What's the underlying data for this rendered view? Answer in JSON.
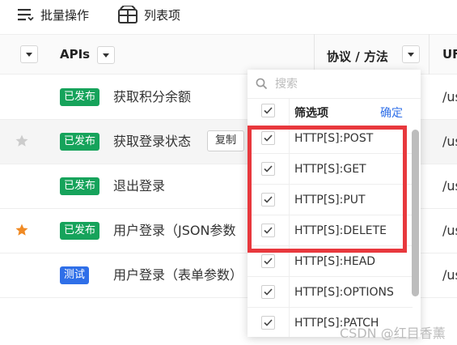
{
  "toolbar": {
    "batch_label": "批量操作",
    "list_label": "列表项"
  },
  "table": {
    "columns": {
      "apis": "APIs",
      "method": "协议 / 方法",
      "url_cut": "UF"
    },
    "rows": [
      {
        "starred": false,
        "status": "已发布",
        "status_type": "published",
        "name": "获取积分余额",
        "url": "/us"
      },
      {
        "starred": false,
        "status": "已发布",
        "status_type": "published",
        "name": "获取登录状态",
        "copy_label": "复制",
        "url": "/us",
        "highlighted": true
      },
      {
        "starred": false,
        "status": "已发布",
        "status_type": "published",
        "name": "退出登录",
        "url": "/us"
      },
      {
        "starred": true,
        "status": "已发布",
        "status_type": "published",
        "name": "用户登录（JSON参数",
        "url": "/us"
      },
      {
        "starred": false,
        "status": "测试",
        "status_type": "testing",
        "name": "用户登录（表单参数）",
        "url": "/us"
      }
    ]
  },
  "filter_dropdown": {
    "search_placeholder": "搜索",
    "title": "筛选项",
    "confirm_label": "确定",
    "options": [
      {
        "label": "HTTP[S]:POST",
        "checked": true
      },
      {
        "label": "HTTP[S]:GET",
        "checked": true
      },
      {
        "label": "HTTP[S]:PUT",
        "checked": true
      },
      {
        "label": "HTTP[S]:DELETE",
        "checked": true
      },
      {
        "label": "HTTP[S]:HEAD",
        "checked": true
      },
      {
        "label": "HTTP[S]:OPTIONS",
        "checked": true
      },
      {
        "label": "HTTP[S]:PATCH",
        "checked": true
      }
    ]
  },
  "watermark": "CSDN @红目香薰",
  "colors": {
    "published_badge": "#16a35b",
    "testing_badge": "#2f6fe8",
    "star_active": "#f08a24",
    "star_inactive": "#cccccc",
    "highlight_box": "#e8383d",
    "link": "#2f6fe8"
  }
}
